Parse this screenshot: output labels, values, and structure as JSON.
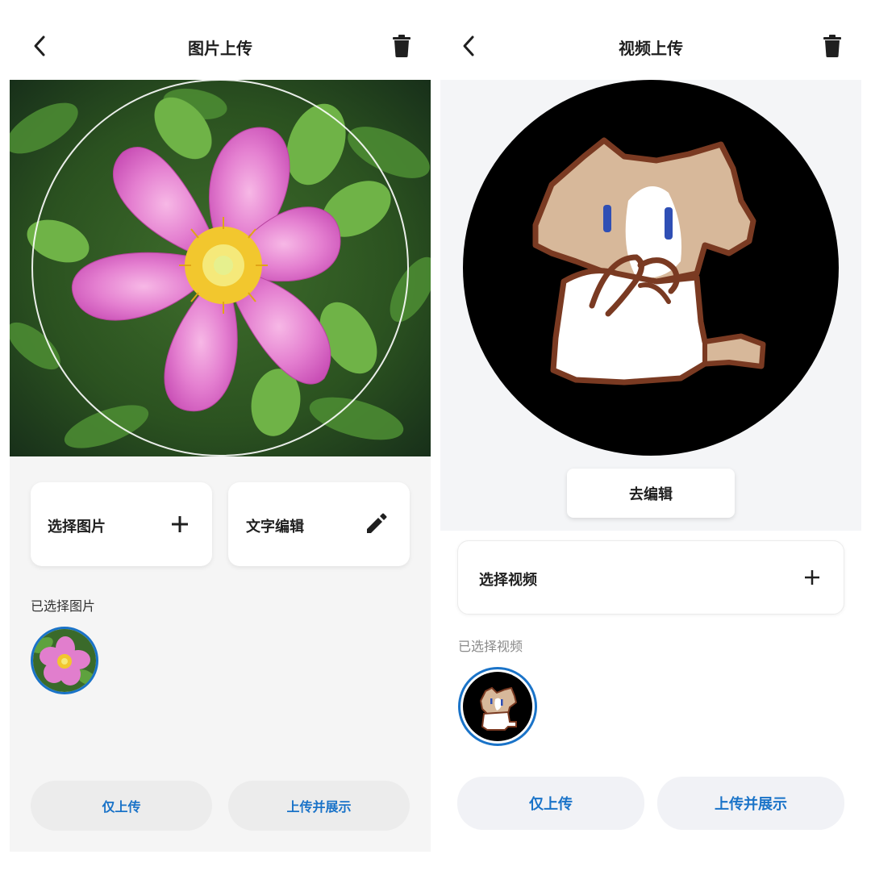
{
  "image_screen": {
    "title": "图片上传",
    "back_icon": "chevron-left-icon",
    "delete_icon": "trash-icon",
    "select_card": {
      "label": "选择图片",
      "icon": "plus-icon"
    },
    "text_edit_card": {
      "label": "文字编辑",
      "icon": "pencil-icon"
    },
    "selected_label": "已选择图片",
    "upload_only": "仅上传",
    "upload_and_show": "上传并展示",
    "accent": "#1a73c8"
  },
  "video_screen": {
    "title": "视频上传",
    "back_icon": "chevron-left-icon",
    "delete_icon": "trash-icon",
    "edit_button": "去编辑",
    "select_card": {
      "label": "选择视频",
      "icon": "plus-icon"
    },
    "selected_label": "已选择视频",
    "upload_only": "仅上传",
    "upload_and_show": "上传并展示",
    "accent": "#1a73c8"
  }
}
